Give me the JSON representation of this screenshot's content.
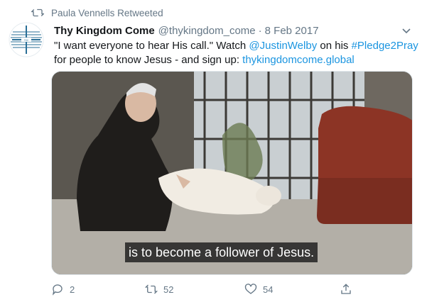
{
  "retweet": {
    "icon": "retweet-icon",
    "text": "Paula Vennells Retweeted"
  },
  "tweet": {
    "author_name": "Thy Kingdom Come",
    "handle": "@thykingdom_come",
    "separator": "·",
    "date": "8 Feb 2017",
    "text": {
      "part1": "\"I want everyone to hear His call.\" Watch ",
      "mention": "@JustinWelby",
      "part2": " on his ",
      "hashtag": "#Pledge2Pray",
      "part3": "for people to know Jesus - and sign up: ",
      "link": "thykingdomcome.global"
    }
  },
  "media": {
    "caption": "is to become a follower of Jesus."
  },
  "actions": {
    "reply_count": "2",
    "retweet_count": "52",
    "like_count": "54"
  },
  "colors": {
    "link": "#1b95e0",
    "muted": "#657786",
    "text": "#14171a"
  }
}
